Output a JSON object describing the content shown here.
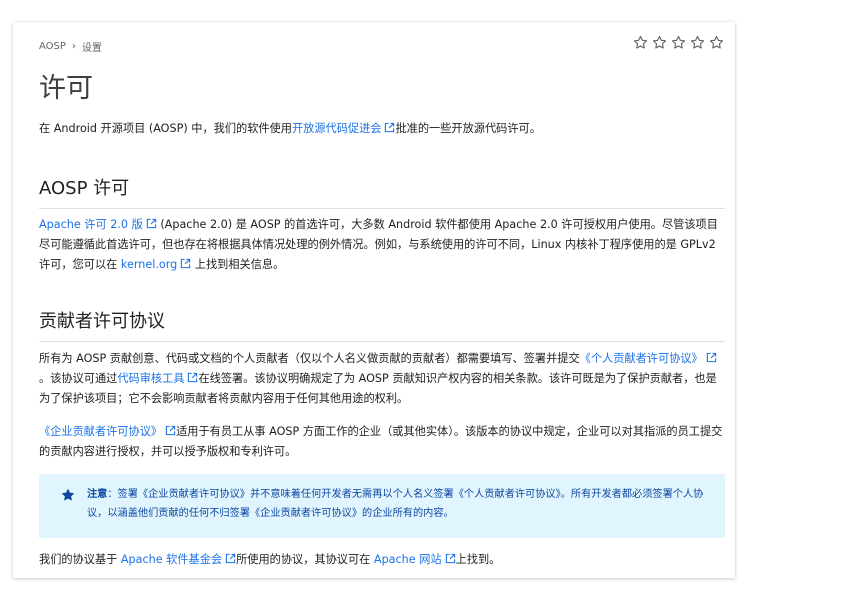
{
  "breadcrumb": {
    "root": "AOSP",
    "current": "设置"
  },
  "title": "许可",
  "intro": {
    "before": "在 Android 开源项目 (AOSP) 中，我们的软件使用",
    "link": "开放源代码促进会",
    "after": "批准的一些开放源代码许可。"
  },
  "aosp_license": {
    "heading": "AOSP 许可",
    "link1": "Apache 许可 2.0 版",
    "text1": " (Apache 2.0) 是 AOSP 的首选许可，大多数 Android 软件都使用 Apache 2.0 许可授权用户使用。尽管该项目尽可能遵循此首选许可，但也存在将根据具体情况处理的例外情况。例如，与系统使用的许可不同，Linux 内核补丁程序使用的是 GPLv2 许可，您可以在 ",
    "link2": "kernel.org",
    "text2": " 上找到相关信息。"
  },
  "cla": {
    "heading": "贡献者许可协议",
    "p1_before": "所有为 AOSP 贡献创意、代码或文档的个人贡献者（仅以个人名义做贡献的贡献者）都需要填写、签署并提交",
    "p1_link1": "《个人贡献者许可协议》",
    "p1_mid": "。该协议可通过",
    "p1_link2": "代码审核工具",
    "p1_after": "在线签署。该协议明确规定了为 AOSP 贡献知识产权内容的相关条款。该许可既是为了保护贡献者，也是为了保护该项目；它不会影响贡献者将贡献内容用于任何其他用途的权利。",
    "p2_link": "《企业贡献者许可协议》",
    "p2_after": "适用于有员工从事 AOSP 方面工作的企业（或其他实体）。该版本的协议中规定，企业可以对其指派的员工提交的贡献内容进行授权，并可以授予版权和专利许可。"
  },
  "note": {
    "label": "注意",
    "text": "：签署《企业贡献者许可协议》并不意味着任何开发者无需再以个人名义签署《个人贡献者许可协议》。所有开发者都必须签署个人协议，以涵盖他们贡献的任何不归签署《企业贡献者许可协议》的企业所有的内容。"
  },
  "footer": {
    "before": "我们的协议基于 ",
    "link1": "Apache 软件基金会",
    "mid": "所使用的协议，其协议可在 ",
    "link2": "Apache 网站",
    "after": "上找到。"
  },
  "colors": {
    "link": "#1a73e8",
    "note_bg": "#e1f5fe",
    "note_text": "#0d47a1"
  },
  "icons": {
    "rating": "star-outline-icon",
    "external": "external-link-icon",
    "note": "star-icon"
  }
}
